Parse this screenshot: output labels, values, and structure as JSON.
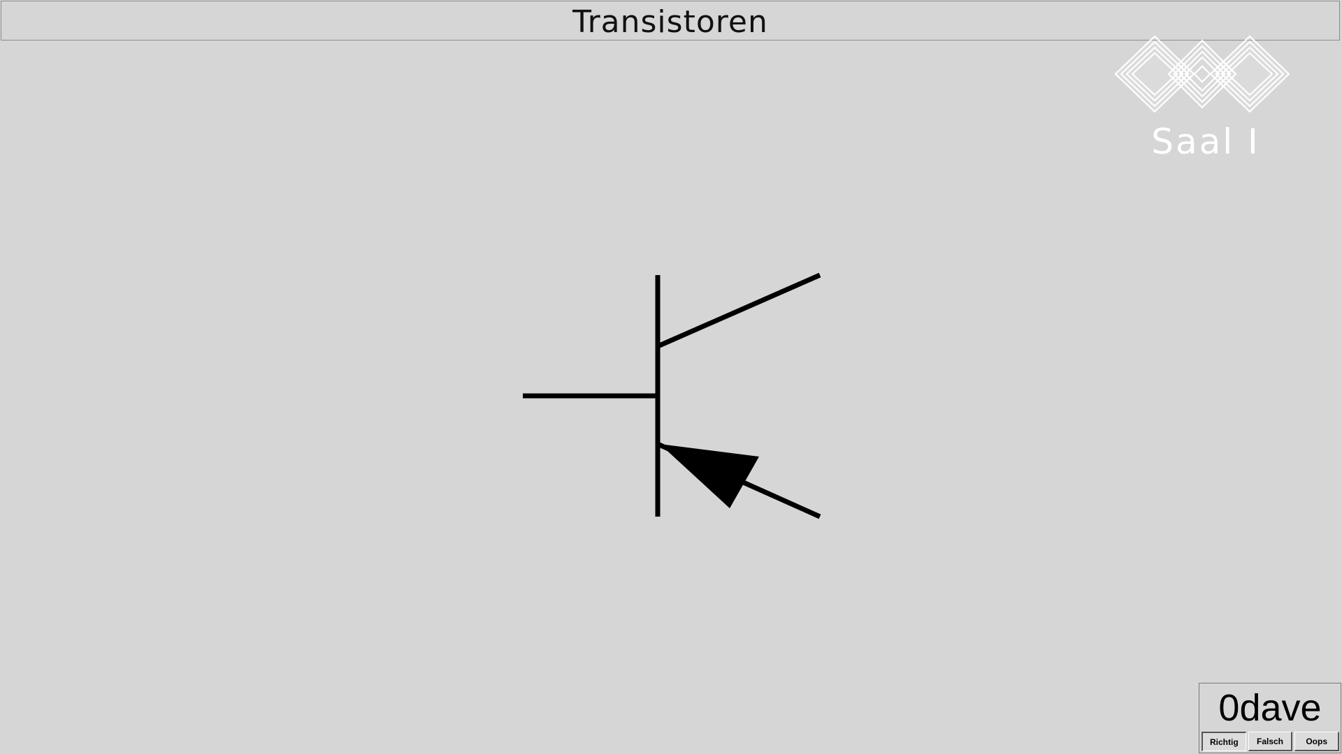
{
  "header": {
    "title": "Transistoren"
  },
  "logo": {
    "icon": "diamond-pattern-logo-icon",
    "text": "Saal I",
    "color": "#ffffff"
  },
  "diagram": {
    "icon": "pnp-transistor-symbol-icon",
    "stroke_color": "#000000"
  },
  "controls": {
    "name": "0dave",
    "buttons": [
      {
        "label": "Richtig"
      },
      {
        "label": "Falsch"
      },
      {
        "label": "Oops"
      }
    ]
  },
  "colors": {
    "background": "#d6d6d6",
    "text": "#111111"
  }
}
